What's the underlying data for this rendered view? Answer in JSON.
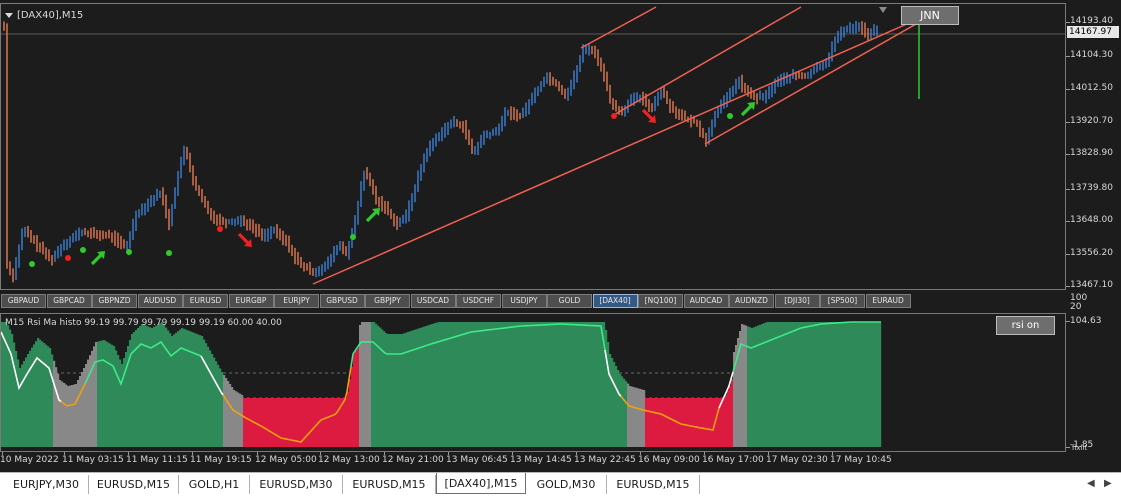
{
  "chart": {
    "title": "[DAX40],M15",
    "button_label": "JNN",
    "current_price": "14167.97",
    "price_labels": [
      "14193.40",
      "14104.30",
      "14012.50",
      "13920.70",
      "13828.90",
      "13739.80",
      "13648.00",
      "13556.20",
      "13467.10"
    ]
  },
  "symbols": [
    "GBPAUD",
    "GBPCAD",
    "GBPNZD",
    "AUDUSD",
    "EURUSD",
    "EURGBP",
    "EURJPY",
    "GBPUSD",
    "GBPJPY",
    "USDCAD",
    "USDCHF",
    "USDJPY",
    "GOLD",
    "[DAX40]",
    "[NQ100]",
    "AUDCAD",
    "AUDNZD",
    "[DJI30]",
    "[SP500]",
    "EURAUD"
  ],
  "active_symbol": "[DAX40]",
  "indicator": {
    "title": "M15 Rsi Ma histo 99.19 99.79 99.79 99.19 99.19 60.00 40.00",
    "button_label": "rsi on",
    "labels": {
      "top": "100",
      "max": "104.63",
      "mid": "20",
      "min": "-1.85",
      "bottom": "fixlit"
    }
  },
  "time_labels": [
    "10 May 2022",
    "11 May 03:15",
    "11 May 11:15",
    "11 May 19:15",
    "12 May 05:00",
    "12 May 13:00",
    "12 May 21:00",
    "13 May 06:45",
    "13 May 14:45",
    "13 May 22:45",
    "16 May 09:00",
    "16 May 17:00",
    "17 May 02:30",
    "17 May 10:45"
  ],
  "tabs": [
    "EURJPY,M30",
    "EURUSD,M15",
    "GOLD,H1",
    "EURUSD,M30",
    "EURUSD,M15",
    "[DAX40],M15",
    "GOLD,M30",
    "EURUSD,M15"
  ],
  "active_tab": "[DAX40],M15",
  "colors": {
    "bull": "#3d82d6",
    "bear": "#e77a52",
    "channel": "#f06050",
    "signal_up": "#2dcc2d",
    "signal_down": "#ee2222",
    "histo_green": "#2e8a58",
    "histo_red": "#dd1b40",
    "histo_gray": "#888888"
  }
}
